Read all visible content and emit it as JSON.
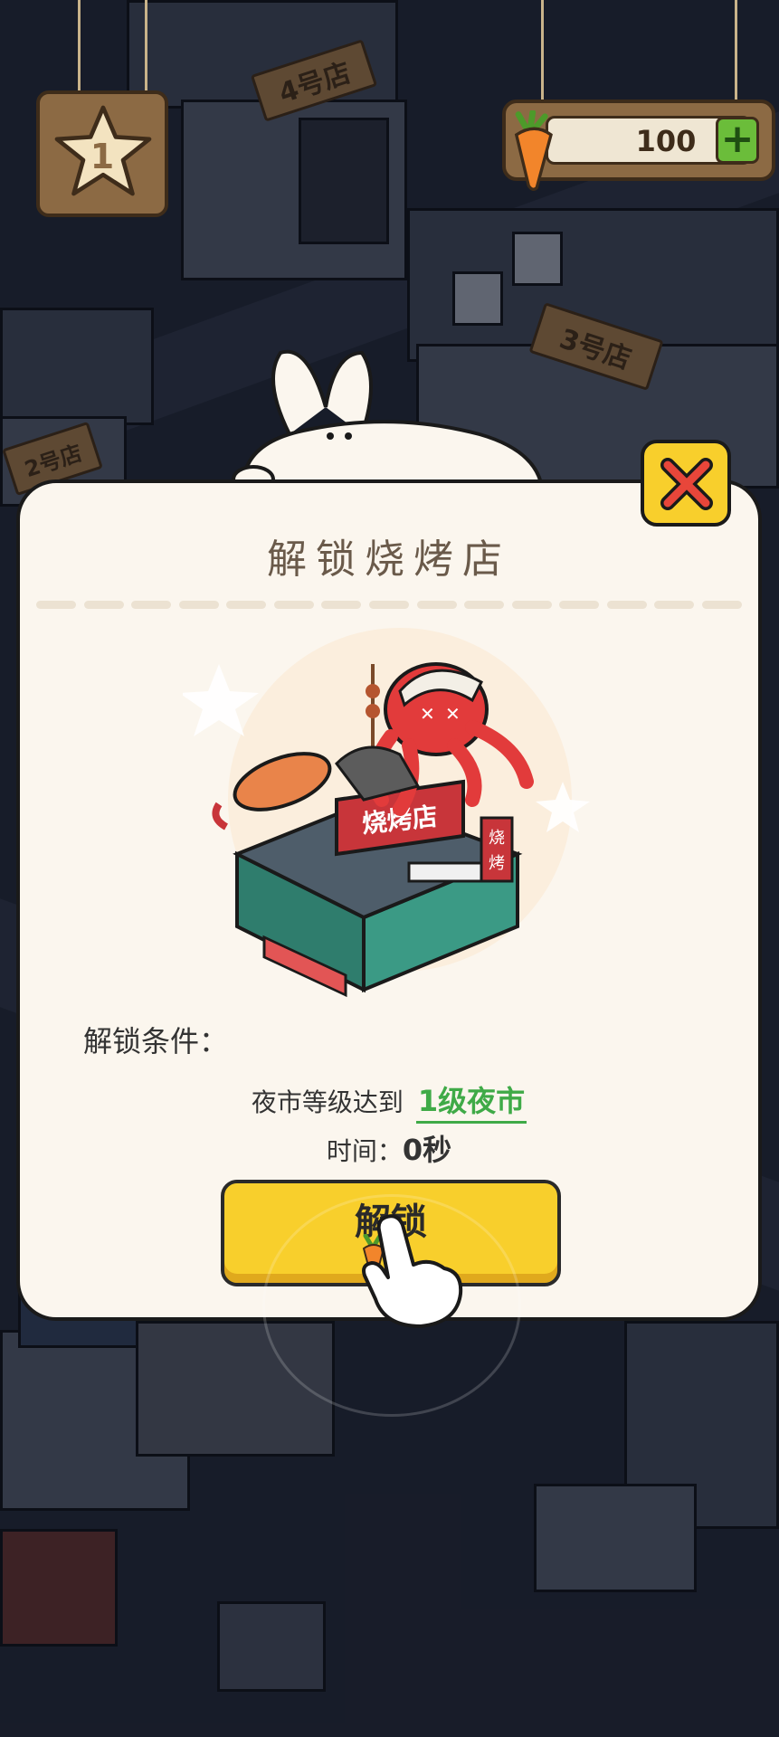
{
  "hud": {
    "level": "1",
    "carrots": "100",
    "add_label": "+"
  },
  "buildings": {
    "shop4": "4号店",
    "shop3": "3号店",
    "shop2": "2号店"
  },
  "dialog": {
    "title": "解锁烧烤店",
    "conditions_label": "解锁条件：",
    "requirement_prefix": "夜市等级达到",
    "requirement_value": "1级夜市",
    "time_prefix": "时间：",
    "time_value": "0秒",
    "unlock_label": "解锁",
    "shop_sign": "烧烤店",
    "side_sign": "烧烤"
  },
  "colors": {
    "button": "#f8cf2c",
    "requirement": "#3faa47",
    "panel": "#fbf6ee"
  },
  "icons": [
    "star-icon",
    "carrot-icon",
    "plus-icon",
    "close-icon",
    "pointer-hand-icon"
  ]
}
